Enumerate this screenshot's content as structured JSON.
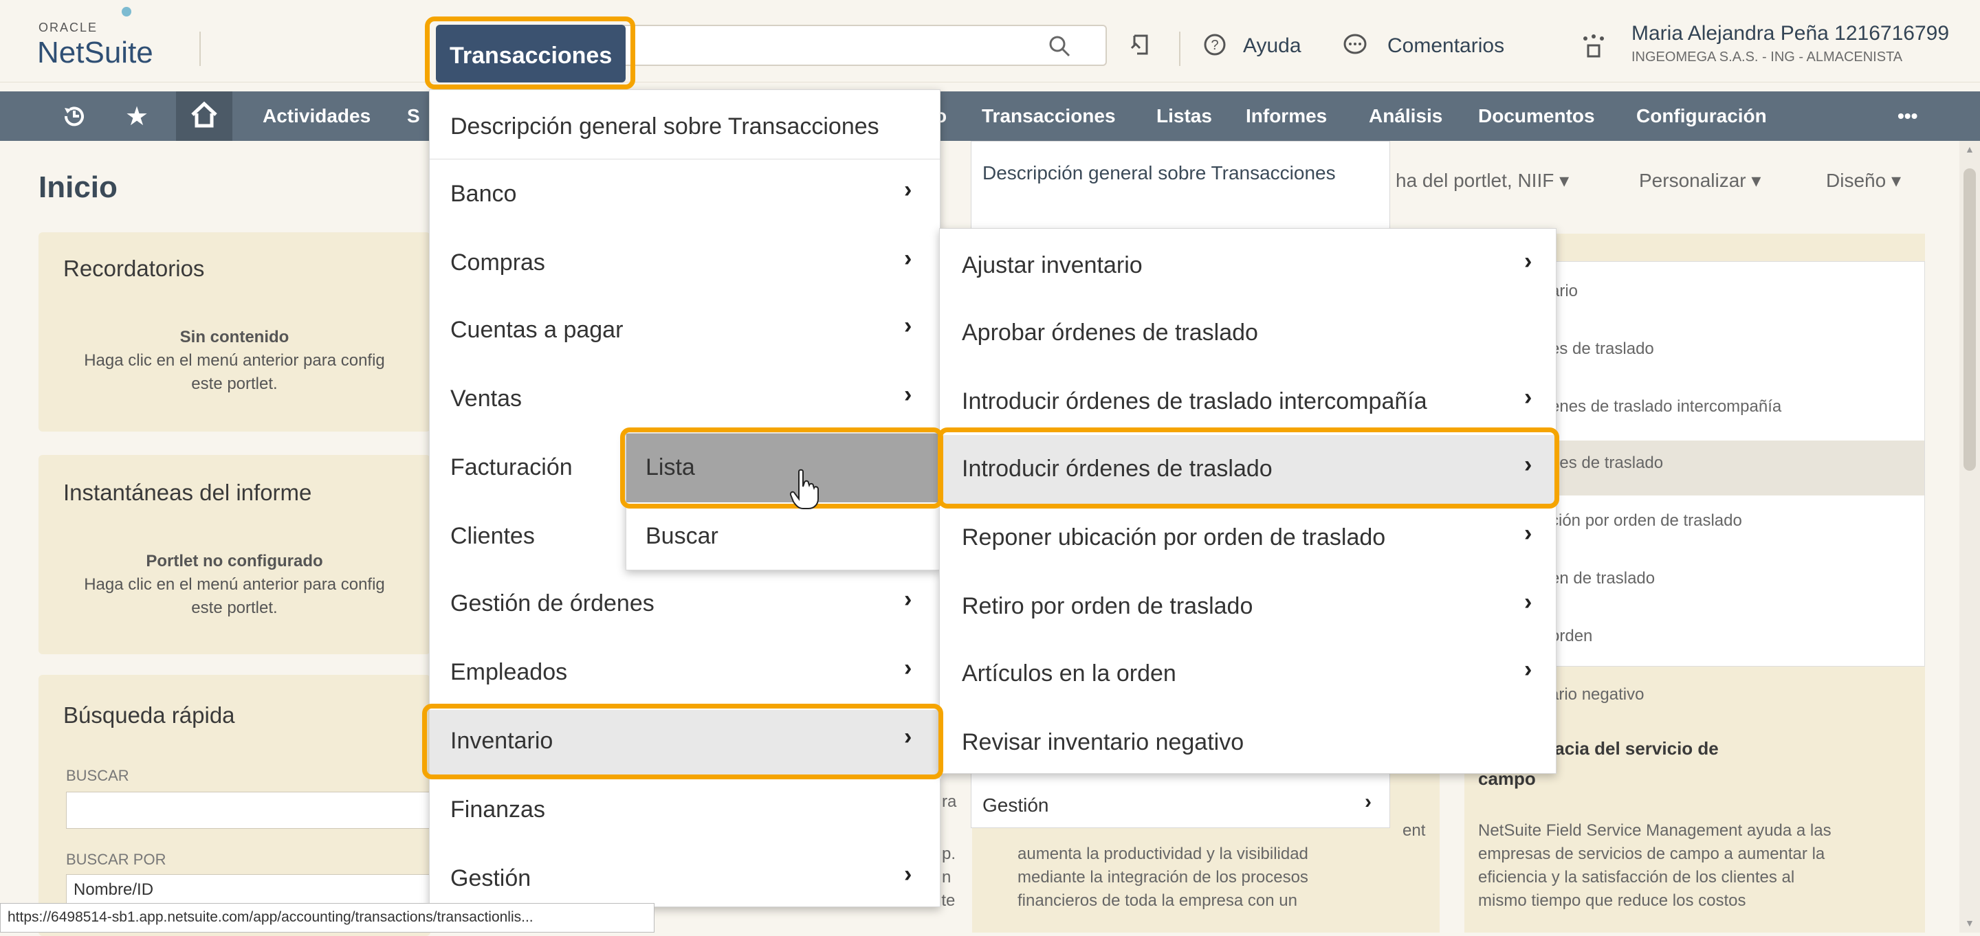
{
  "header": {
    "logo_top": "ORACLE",
    "logo_main": "NetSuite",
    "active_menu": "Transacciones",
    "help": "Ayuda",
    "comments": "Comentarios",
    "user_name": "Maria Alejandra Peña 1216716799",
    "user_company": "INGEOMEGA S.A.S. - ING - ALMACENISTA"
  },
  "nav": {
    "items": [
      "Actividades",
      "S",
      "Transacciones",
      "Listas",
      "Informes",
      "Análisis",
      "Documentos",
      "Configuración",
      "•••"
    ],
    "fragment": "o"
  },
  "page": {
    "title": "Inicio",
    "toolbar": [
      "ha del portlet, NIIF ▾",
      "Personalizar ▾",
      "Diseño ▾"
    ]
  },
  "portlets": {
    "reminders": {
      "title": "Recordatorios",
      "msg_bold": "Sin contenido",
      "msg1": "Haga clic en el menú anterior para config",
      "msg2": "este portlet."
    },
    "snapshots": {
      "title": "Instantáneas del informe",
      "msg_bold": "Portlet no configurado",
      "msg1": "Haga clic en el menú anterior para config",
      "msg2": "este portlet."
    },
    "quicksearch": {
      "title": "Búsqueda rápida",
      "search_label": "BUSCAR",
      "search_by_label": "BUSCAR POR",
      "search_by_value": "Nombre/ID"
    }
  },
  "menu1": {
    "items": [
      "Descripción general sobre Transacciones",
      "Banco",
      "Compras",
      "Cuentas a pagar",
      "Ventas",
      "Facturación",
      "Clientes",
      "Gestión de órdenes",
      "Empleados",
      "Inventario",
      "Finanzas",
      "Gestión"
    ]
  },
  "submenu_facturacion": {
    "items": [
      "Lista",
      "Buscar"
    ]
  },
  "menu_inventario": {
    "items": [
      "Ajustar inventario",
      "Aprobar órdenes de traslado",
      "Introducir órdenes de traslado intercompañía",
      "Introducir órdenes de traslado",
      "Reponer ubicación por orden de traslado",
      "Retiro por orden de traslado",
      "Artículos en la orden",
      "Revisar inventario negativo"
    ]
  },
  "bg_menu": {
    "title": "Descripción general sobre Transacciones",
    "bottom": "Gestión"
  },
  "bg_right": {
    "items": [
      "ario",
      "es de traslado",
      "enes de traslado intercompañía",
      "nes de traslado",
      "ción por orden de traslado",
      "en de traslado",
      "orden",
      "ario negativo"
    ],
    "card_title1": "de la eficacia del servicio de",
    "card_title2": "campo",
    "card_text": [
      "NetSuite Field Service Management ayuda a las",
      "empresas de servicios de campo a aumentar la",
      "eficiencia y la satisfacción de los clientes al",
      "mismo tiempo que reduce los costos"
    ]
  },
  "bg_middle": {
    "text": [
      "aumenta la productividad y la visibilidad",
      "mediante la integración de los procesos",
      "financieros de toda la empresa con un"
    ],
    "ent": "ent",
    "ra": "ra",
    "p": "p.",
    "n": "n",
    "ite": "ite"
  },
  "status_url": "https://6498514-sb1.app.netsuite.com/app/accounting/transactions/transactionlis..."
}
